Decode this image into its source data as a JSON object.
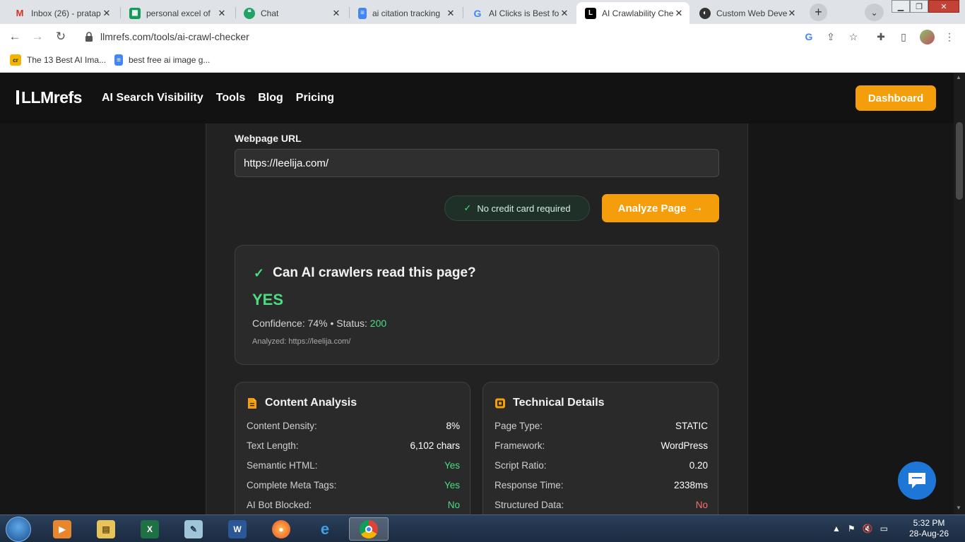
{
  "browser": {
    "tabs": [
      {
        "title": "Inbox (26) - pratap",
        "icon": "gmail-icon"
      },
      {
        "title": "personal excel of",
        "icon": "sheets-icon"
      },
      {
        "title": "Chat",
        "icon": "chat-icon"
      },
      {
        "title": "ai citation tracking",
        "icon": "docs-icon"
      },
      {
        "title": "AI Clicks is Best fo",
        "icon": "google-icon"
      },
      {
        "title": "AI Crawlability Che",
        "icon": "llmrefs-icon",
        "active": true
      },
      {
        "title": "Custom Web Deve",
        "icon": "web-icon"
      }
    ],
    "url": "llmrefs.com/tools/ai-crawl-checker",
    "bookmarks": [
      {
        "label": "The 13 Best AI Ima...",
        "icon": "cr-icon"
      },
      {
        "label": "best free ai image g...",
        "icon": "docs-icon"
      }
    ]
  },
  "site": {
    "logo": "LLMrefs",
    "nav": [
      "AI Search Visibility",
      "Tools",
      "Blog",
      "Pricing"
    ],
    "dashboard_label": "Dashboard"
  },
  "form": {
    "url_label": "Webpage URL",
    "url_value": "https://leelija.com/",
    "badge": "No credit card required",
    "analyze_label": "Analyze Page"
  },
  "result": {
    "question": "Can AI crawlers read this page?",
    "answer": "YES",
    "confidence_label": "Confidence: 74% • Status: ",
    "status_code": "200",
    "analyzed": "Analyzed: https://leelija.com/"
  },
  "content_analysis": {
    "title": "Content Analysis",
    "rows": [
      {
        "label": "Content Density:",
        "value": "8%"
      },
      {
        "label": "Text Length:",
        "value": "6,102 chars"
      },
      {
        "label": "Semantic HTML:",
        "value": "Yes"
      },
      {
        "label": "Complete Meta Tags:",
        "value": "Yes"
      },
      {
        "label": "AI Bot Blocked:",
        "value": "No"
      }
    ]
  },
  "technical_details": {
    "title": "Technical Details",
    "rows": [
      {
        "label": "Page Type:",
        "value": "STATIC"
      },
      {
        "label": "Framework:",
        "value": "WordPress"
      },
      {
        "label": "Script Ratio:",
        "value": "0.20"
      },
      {
        "label": "Response Time:",
        "value": "2338ms"
      },
      {
        "label": "Structured Data:",
        "value": "No"
      }
    ]
  },
  "taskbar": {
    "time": "5:32 PM",
    "date": "28-Aug-26"
  },
  "colors": {
    "accent": "#f59e0b",
    "success": "#4ade80",
    "danger": "#f87171",
    "background": "#161616"
  }
}
